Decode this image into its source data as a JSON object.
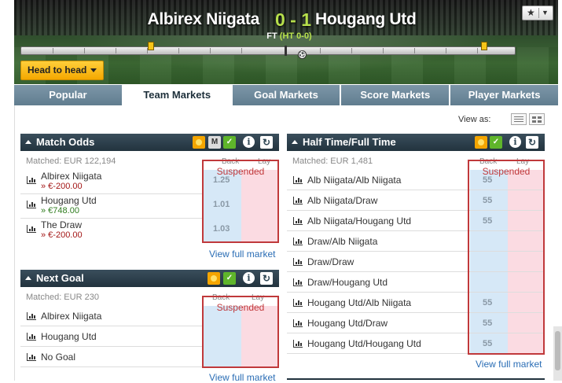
{
  "match": {
    "home_team": "Albirex Niigata",
    "away_team": "Hougang Utd",
    "score": "0 - 1",
    "status": "FT",
    "half_time": "(HT 0-0)"
  },
  "header": {
    "favorite_icon": "star-icon",
    "head_to_head_label": "Head to head"
  },
  "tabs": [
    {
      "label": "Popular",
      "active": false
    },
    {
      "label": "Team Markets",
      "active": true
    },
    {
      "label": "Goal Markets",
      "active": false
    },
    {
      "label": "Score Markets",
      "active": false
    },
    {
      "label": "Player Markets",
      "active": false
    }
  ],
  "view_as_label": "View as:",
  "match_odds": {
    "title": "Match Odds",
    "matched": "Matched: EUR 122,194",
    "back_label": "Back",
    "lay_label": "Lay",
    "suspended": "Suspended",
    "runners": [
      {
        "name": "Albirex Niigata",
        "pl": "» €-200.00",
        "back": "1.25"
      },
      {
        "name": "Hougang Utd",
        "pl": "» €748.00",
        "back": "1.01"
      },
      {
        "name": "The Draw",
        "pl": "» €-200.00",
        "back": "1.03"
      }
    ],
    "view_full": "View full market"
  },
  "next_goal": {
    "title": "Next Goal",
    "matched": "Matched: EUR 230",
    "back_label": "Back",
    "lay_label": "Lay",
    "suspended": "Suspended",
    "runners": [
      {
        "name": "Albirex Niigata"
      },
      {
        "name": "Hougang Utd"
      },
      {
        "name": "No Goal"
      }
    ],
    "view_full": "View full market"
  },
  "htft": {
    "title": "Half Time/Full Time",
    "matched": "Matched: EUR 1,481",
    "back_label": "Back",
    "lay_label": "Lay",
    "suspended": "Suspended",
    "runners": [
      {
        "name": "Alb Niigata/Alb Niigata",
        "back": "55"
      },
      {
        "name": "Alb Niigata/Draw",
        "back": "55"
      },
      {
        "name": "Alb Niigata/Hougang Utd",
        "back": "55"
      },
      {
        "name": "Draw/Alb Niigata",
        "back": ""
      },
      {
        "name": "Draw/Draw",
        "back": ""
      },
      {
        "name": "Draw/Hougang Utd",
        "back": ""
      },
      {
        "name": "Hougang Utd/Alb Niigata",
        "back": "55"
      },
      {
        "name": "Hougang Utd/Draw",
        "back": "55"
      },
      {
        "name": "Hougang Utd/Hougang Utd",
        "back": "55"
      }
    ],
    "view_full": "View full market"
  },
  "icons": {
    "m": "M",
    "info": "i",
    "refresh": "↻",
    "check": "✓"
  }
}
